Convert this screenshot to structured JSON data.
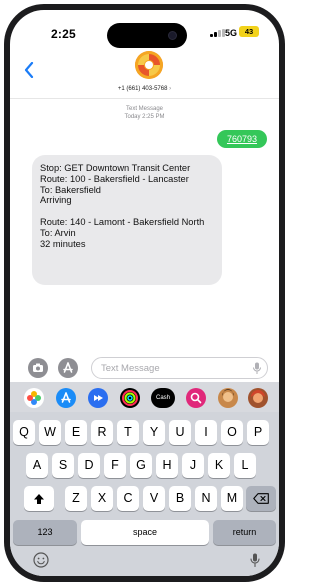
{
  "status_bar": {
    "time": "2:25",
    "network": "5G",
    "battery": "43"
  },
  "header": {
    "back_icon": "chevron-left-icon",
    "contact": "+1 (661) 403-5768",
    "contact_chevron": "›"
  },
  "thread": {
    "meta_line1": "Text Message",
    "meta_line2": "Today 2:25 PM",
    "outgoing": {
      "text": "760793"
    },
    "incoming": {
      "text": "Stop: GET Downtown Transit Center\nRoute: 100 - Bakersfield - Lancaster\nTo: Bakersfield\nArriving\n\nRoute: 140 - Lamont - Bakersfield North\nTo: Arvin\n32 minutes"
    }
  },
  "composer": {
    "placeholder": "Text Message",
    "value": ""
  },
  "app_strip": {
    "icons": [
      "photos-icon",
      "app-store-icon",
      "clips-icon",
      "fitness-icon",
      "apple-cash-icon",
      "search-icon",
      "memoji-icon",
      "memoji-icon"
    ],
    "cash_label": "Cash"
  },
  "keyboard": {
    "row1": [
      "Q",
      "W",
      "E",
      "R",
      "T",
      "Y",
      "U",
      "I",
      "O",
      "P"
    ],
    "row2": [
      "A",
      "S",
      "D",
      "F",
      "G",
      "H",
      "J",
      "K",
      "L"
    ],
    "row3": [
      "Z",
      "X",
      "C",
      "V",
      "B",
      "N",
      "M"
    ],
    "numbers_label": "123",
    "space_label": "space",
    "return_label": "return"
  },
  "colors": {
    "accent": "#1b7cf7",
    "outgoing_bubble": "#34c759",
    "incoming_bubble": "#e9e9eb"
  }
}
